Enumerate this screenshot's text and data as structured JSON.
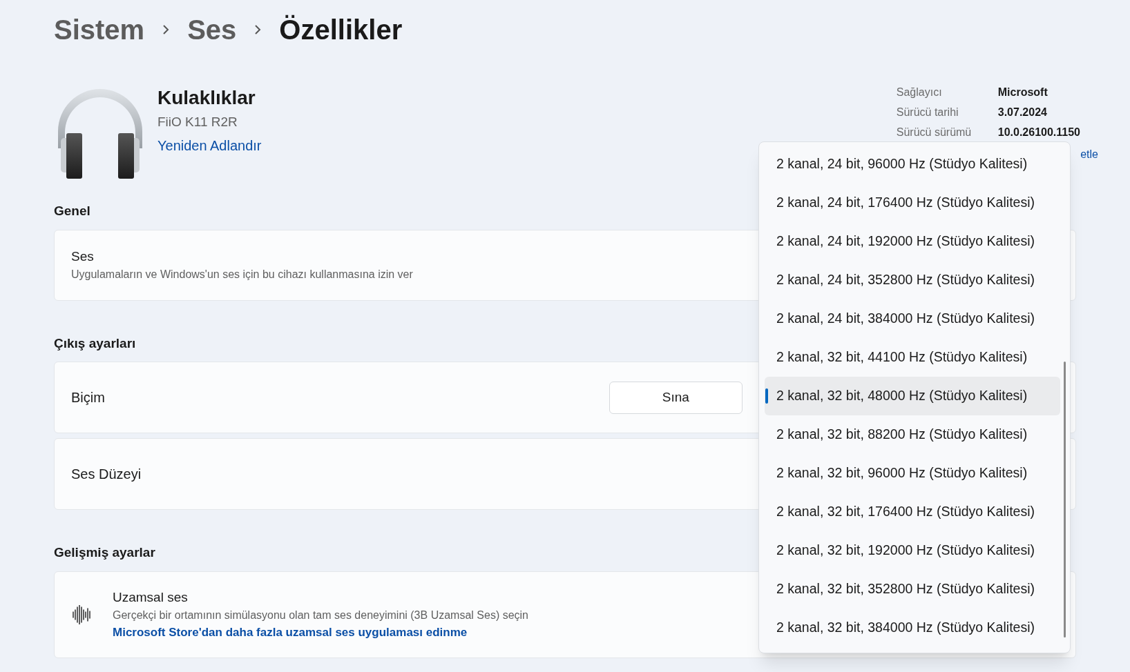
{
  "breadcrumb": [
    {
      "label": "Sistem",
      "current": false
    },
    {
      "label": "Ses",
      "current": false
    },
    {
      "label": "Özellikler",
      "current": true
    }
  ],
  "device": {
    "name": "Kulaklıklar",
    "model": "FiiO K11 R2R",
    "rename_link": "Yeniden Adlandır"
  },
  "driver_info": [
    {
      "label": "Sağlayıcı",
      "value": "Microsoft"
    },
    {
      "label": "Sürücü tarihi",
      "value": "3.07.2024"
    },
    {
      "label": "Sürücü sürümü",
      "value": "10.0.26100.1150"
    }
  ],
  "driver_link": "etle",
  "sections": [
    {
      "title": "Genel",
      "cards": [
        {
          "kind": "toggle",
          "title": "Ses",
          "description": "Uygulamaların ve Windows'un ses için bu cihazı kullanmasına izin ver"
        }
      ]
    },
    {
      "title": "Çıkış ayarları",
      "cards": [
        {
          "kind": "format",
          "title": "Biçim",
          "button": "Sına"
        },
        {
          "kind": "plain",
          "title": "Ses Düzeyi"
        }
      ]
    },
    {
      "title": "Gelişmiş ayarlar",
      "cards": [
        {
          "kind": "spatial",
          "title": "Uzamsal ses",
          "description": "Gerçekçi bir ortamının simülasyonu olan tam ses deneyimini (3B Uzamsal Ses) seçin",
          "link": "Microsoft Store'dan daha fazla uzamsal ses uygulaması edinme"
        }
      ]
    }
  ],
  "format_options": [
    {
      "label": "2 kanal, 24 bit, 96000 Hz (Stüdyo Kalitesi)",
      "selected": false
    },
    {
      "label": "2 kanal, 24 bit, 176400 Hz (Stüdyo Kalitesi)",
      "selected": false
    },
    {
      "label": "2 kanal, 24 bit, 192000 Hz (Stüdyo Kalitesi)",
      "selected": false
    },
    {
      "label": "2 kanal, 24 bit, 352800 Hz (Stüdyo Kalitesi)",
      "selected": false
    },
    {
      "label": "2 kanal, 24 bit, 384000 Hz (Stüdyo Kalitesi)",
      "selected": false
    },
    {
      "label": "2 kanal, 32 bit, 44100 Hz (Stüdyo Kalitesi)",
      "selected": false
    },
    {
      "label": "2 kanal, 32 bit, 48000 Hz (Stüdyo Kalitesi)",
      "selected": true
    },
    {
      "label": "2 kanal, 32 bit, 88200 Hz (Stüdyo Kalitesi)",
      "selected": false
    },
    {
      "label": "2 kanal, 32 bit, 96000 Hz (Stüdyo Kalitesi)",
      "selected": false
    },
    {
      "label": "2 kanal, 32 bit, 176400 Hz (Stüdyo Kalitesi)",
      "selected": false
    },
    {
      "label": "2 kanal, 32 bit, 192000 Hz (Stüdyo Kalitesi)",
      "selected": false
    },
    {
      "label": "2 kanal, 32 bit, 352800 Hz (Stüdyo Kalitesi)",
      "selected": false
    },
    {
      "label": "2 kanal, 32 bit, 384000 Hz (Stüdyo Kalitesi)",
      "selected": false
    }
  ]
}
